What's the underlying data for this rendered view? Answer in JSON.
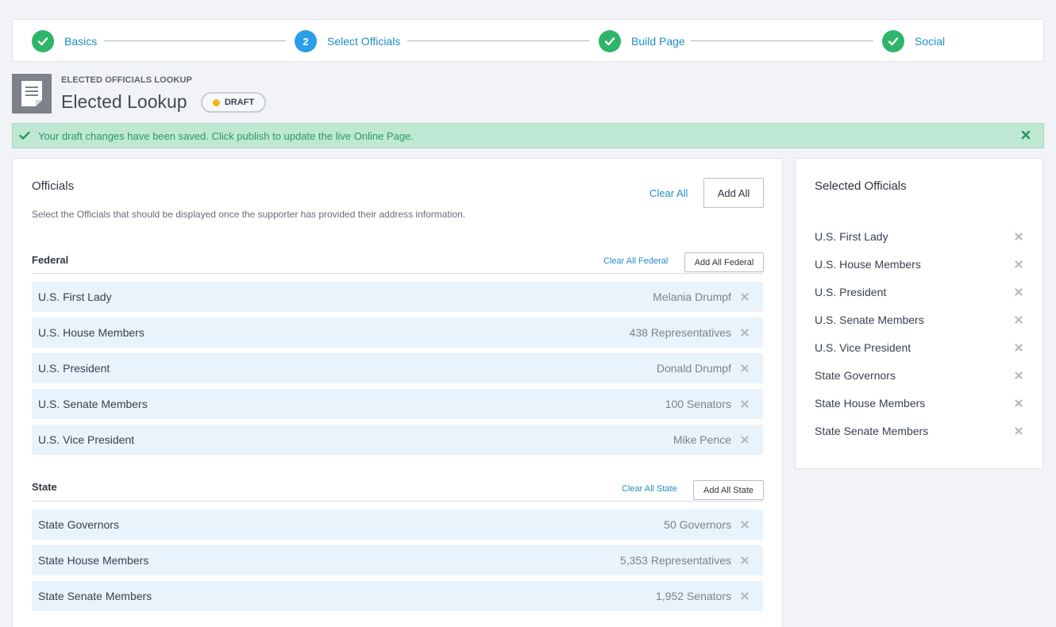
{
  "stepper": {
    "steps": [
      {
        "label": "Basics",
        "status": "done"
      },
      {
        "label": "Select Officials",
        "status": "current",
        "number": "2"
      },
      {
        "label": "Build Page",
        "status": "done"
      },
      {
        "label": "Social",
        "status": "done"
      }
    ]
  },
  "header": {
    "eyebrow": "ELECTED OFFICIALS LOOKUP",
    "title": "Elected Lookup",
    "badge": "DRAFT"
  },
  "alert": {
    "message": "Your draft changes have been saved. Click publish to update the live Online Page."
  },
  "officials": {
    "title": "Officials",
    "description": "Select the Officials that should be displayed once the supporter has provided their address information.",
    "clear_all": "Clear All",
    "add_all": "Add All",
    "sections": [
      {
        "title": "Federal",
        "clear_label": "Clear All Federal",
        "add_label": "Add All Federal",
        "rows": [
          {
            "name": "U.S. First Lady",
            "detail": "Melania Drumpf"
          },
          {
            "name": "U.S. House Members",
            "detail": "438 Representatives"
          },
          {
            "name": "U.S. President",
            "detail": "Donald Drumpf"
          },
          {
            "name": "U.S. Senate Members",
            "detail": "100 Senators"
          },
          {
            "name": "U.S. Vice President",
            "detail": "Mike Pence"
          }
        ]
      },
      {
        "title": "State",
        "clear_label": "Clear All State",
        "add_label": "Add All State",
        "rows": [
          {
            "name": "State Governors",
            "detail": "50 Governors"
          },
          {
            "name": "State House Members",
            "detail": "5,353 Representatives"
          },
          {
            "name": "State Senate Members",
            "detail": "1,952 Senators"
          }
        ]
      }
    ]
  },
  "selected": {
    "title": "Selected Officials",
    "items": [
      "U.S. First Lady",
      "U.S. House Members",
      "U.S. President",
      "U.S. Senate Members",
      "U.S. Vice President",
      "State Governors",
      "State House Members",
      "State Senate Members"
    ]
  },
  "colors": {
    "accent": "#1e8fc6",
    "success": "#2fb56a",
    "current_step": "#2a9ee8",
    "alert_bg": "#bfe8d4",
    "row_bg": "#e8f3fb",
    "draft_dot": "#f3b415"
  },
  "icons": {
    "step_done": "checkmark-icon",
    "doc": "document-icon",
    "alert_check": "checkmark-icon",
    "alert_close": "close-icon",
    "row_remove": "close-icon"
  }
}
